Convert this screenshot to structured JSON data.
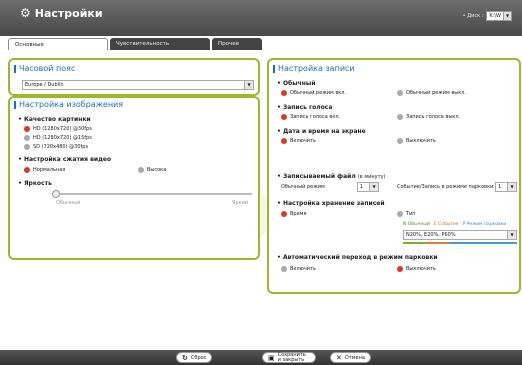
{
  "app": {
    "title": "Настройки"
  },
  "disk": {
    "label": "• Диск :",
    "value": "K:\\W"
  },
  "tabs": [
    "Основные",
    "Чувствительность",
    "Прочее"
  ],
  "timezone": {
    "title": "Часовой пояс",
    "value": "Europe / Dublin"
  },
  "image": {
    "title": "Настройка изображения",
    "quality": {
      "title": "Качество картинки",
      "options": [
        "HD (1280x720) @30fps",
        "HD (1280x720) @15fps",
        "SD (720x480) @30fps"
      ],
      "selected": 0
    },
    "compression": {
      "title": "Настройка сжатия видео",
      "options": [
        "Нормальная",
        "Высока"
      ],
      "selected": 0
    },
    "brightness": {
      "title": "Яркость",
      "low": "Обычный",
      "high": "Яркий",
      "value": 0.0
    }
  },
  "record": {
    "title": "Настройка записи",
    "normal": {
      "title": "Обычный",
      "on": "Обычный режим вкл.",
      "off": "Обычный режим выкл.",
      "selected": 0
    },
    "voice": {
      "title": "Запись голоса",
      "on": "Запись голоса вкл.",
      "off": "Запись голоса выкл.",
      "selected": 0
    },
    "datetime": {
      "title": "Дата и время на экране",
      "on": "Включить",
      "off": "Выключить",
      "selected": 0
    },
    "file": {
      "title": "Записываемый файл",
      "unit": "(в минуту)",
      "normal_label": "Обычный режим",
      "normal_value": "1",
      "event_label": "Событие/Запись в режиме парковки",
      "event_value": "1"
    },
    "storage": {
      "title": "Настройка хранение записей",
      "time": "Время",
      "type": "Тип",
      "selected": 0,
      "legend": [
        "N Обычный",
        "E Событие",
        "P Режим парковки"
      ],
      "value": "N20%, E20%, P60%"
    },
    "auto_parking": {
      "title": "Автоматический переход в режим парковки",
      "on": "Включить",
      "off": "Выключить",
      "selected": 1
    }
  },
  "buttons": {
    "reset": "Сброс",
    "save": "Сохранить и закрыть",
    "cancel": "Отмена"
  }
}
